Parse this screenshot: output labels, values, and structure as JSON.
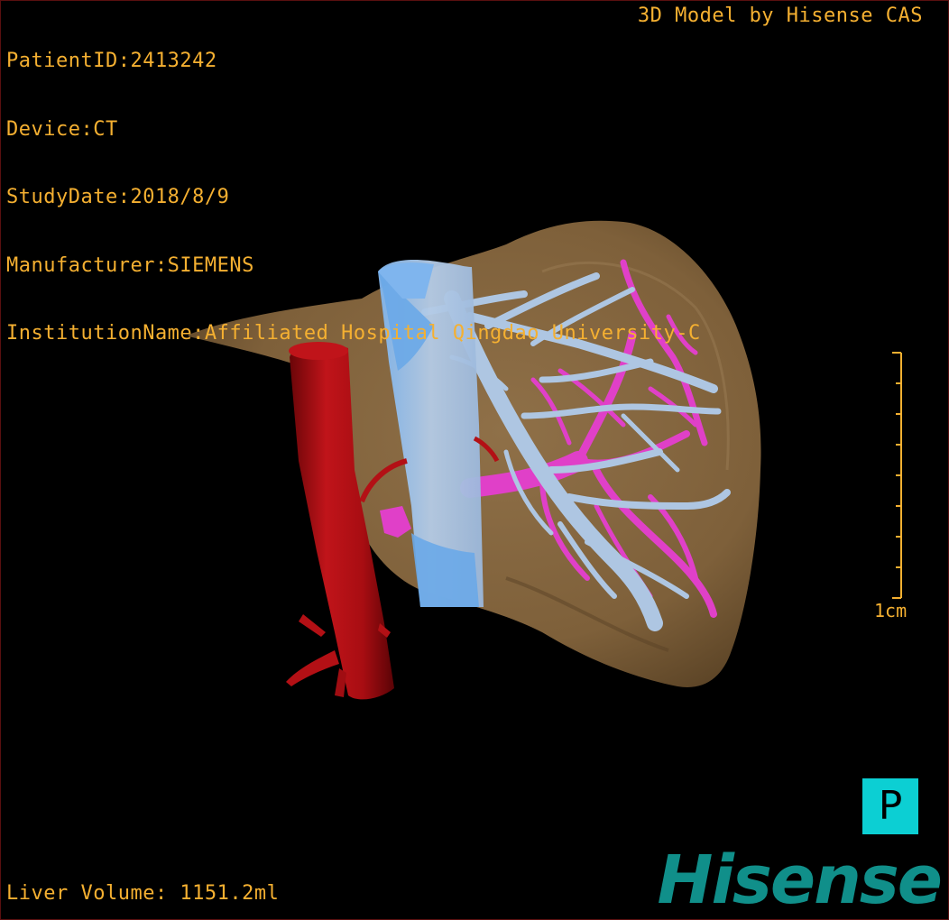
{
  "patient_info": {
    "patient_id": "PatientID:2413242",
    "device": "Device:CT",
    "study_date": "StudyDate:2018/8/9",
    "manufacturer": "Manufacturer:SIEMENS",
    "institution": "InstitutionName:Affiliated Hospital Qingdao University-C"
  },
  "watermark": "3D Model by Hisense CAS",
  "liver_volume": "Liver Volume: 1151.2ml",
  "scale_bar": {
    "label": "1cm"
  },
  "orientation": {
    "label": "P"
  },
  "brand": "Hisense",
  "colors": {
    "overlay_text": "#f5b031",
    "liver": "#8a6b40",
    "artery": "#b31015",
    "vena_cava": "#6aa8e8",
    "hepatic_veins": "#aec6e2",
    "portal_vein": "#e040c8",
    "orientation_badge": "#0ccfd3",
    "brand": "#108f8a"
  }
}
